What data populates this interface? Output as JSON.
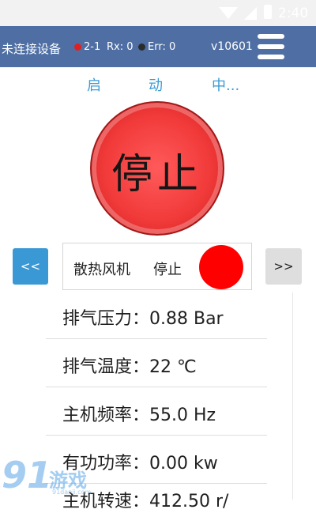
{
  "status_bar": {
    "time": "2:40"
  },
  "app_bar": {
    "connection": "未连接设备",
    "indicator1_text": "2-1",
    "rx_text": "Rx: 0",
    "err_text": "Err: 0",
    "version": "v10601",
    "colors": {
      "bar": "#4f6fa4",
      "dot1": "#e02020",
      "dot2": "#2b2b2b"
    }
  },
  "run_status": {
    "chars": [
      "启",
      "动",
      "中..."
    ]
  },
  "stop_button": {
    "label": "停止",
    "color": "#f23b3b"
  },
  "nav": {
    "prev_label": "<<",
    "next_label": ">>"
  },
  "fan": {
    "label": "散热风机",
    "state": "停止",
    "indicator_color": "#ff0000"
  },
  "readings": [
    {
      "text": "排气压力：0.88 Bar"
    },
    {
      "text": "排气温度：22 ℃"
    },
    {
      "text": "主机频率：55.0 Hz"
    },
    {
      "text": "有功功率：0.00 kw"
    },
    {
      "text": "主机转速：412.50 r/"
    }
  ],
  "watermark": {
    "big": "91",
    "small": "游戏",
    "tiny": "91danji.com"
  }
}
